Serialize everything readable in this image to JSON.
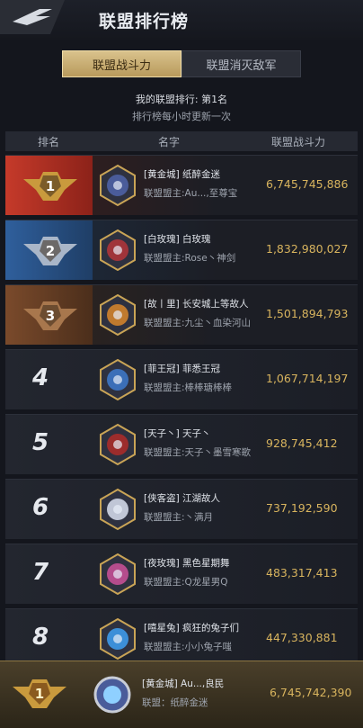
{
  "header": {
    "title": "联盟排行榜"
  },
  "tabs": [
    {
      "label": "联盟战斗力",
      "active": true
    },
    {
      "label": "联盟消灭敌军",
      "active": false
    }
  ],
  "info": {
    "my_rank_label": "我的联盟排行: 第1名",
    "update_note": "排行榜每小时更新一次"
  },
  "table": {
    "columns": [
      "排名",
      "名字",
      "联盟战斗力"
    ],
    "rows": [
      {
        "rank": "1",
        "alliance": "[黄金城] 纸醉金迷",
        "leader": "联盟盟主:Au...,至尊宝",
        "power": "6,745,745,886"
      },
      {
        "rank": "2",
        "alliance": "[白玫瑰] 白玫瑰",
        "leader": "联盟盟主:Rose丶神剑",
        "power": "1,832,980,027"
      },
      {
        "rank": "3",
        "alliance": "[故丨里] 长安城上等故人",
        "leader": "联盟盟主:九尘丶血染河山",
        "power": "1,501,894,793"
      },
      {
        "rank": "4",
        "alliance": "[菲王冠] 菲悉王冠",
        "leader": "联盟盟主:棒棒瑭棒棒",
        "power": "1,067,714,197"
      },
      {
        "rank": "5",
        "alliance": "[天子丶] 天子丶",
        "leader": "联盟盟主:天子丶墨雪寒歌",
        "power": "928,745,412"
      },
      {
        "rank": "6",
        "alliance": "[侠客盗] 江湖故人",
        "leader": "联盟盟主:丶满月",
        "power": "737,192,590"
      },
      {
        "rank": "7",
        "alliance": "[夜玫瑰] 黑色星期舞",
        "leader": "联盟盟主:Q龙星男Q",
        "power": "483,317,413"
      },
      {
        "rank": "8",
        "alliance": "[嘻星兔] 疯狂的兔子们",
        "leader": "联盟盟主:小小兔子嗤",
        "power": "447,330,881"
      }
    ]
  },
  "footer": {
    "rank": "1",
    "alliance": "[黄金城] Au...,良民",
    "leader": "联盟：纸醉金迷",
    "power": "6,745,742,390"
  }
}
